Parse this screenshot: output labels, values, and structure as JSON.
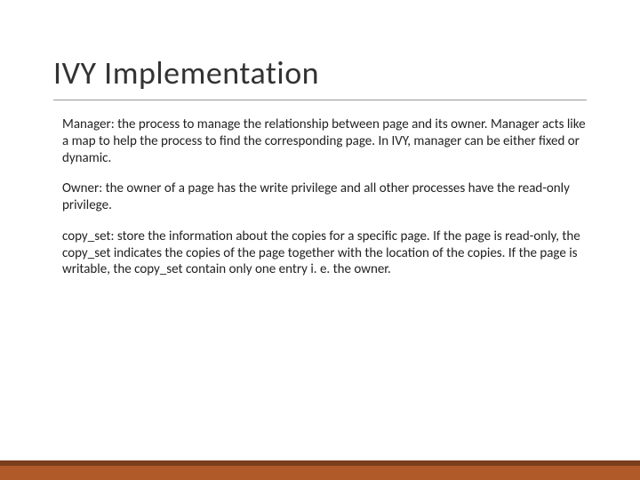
{
  "slide": {
    "title": "IVY Implementation",
    "paragraphs": [
      "Manager: the process to manage the relationship between  page and its owner. Manager acts like a map to help the process to find the corresponding page. In IVY, manager can be either fixed or dynamic.",
      "Owner: the owner of a page has the write privilege and all other processes have the read-only privilege.",
      "copy_set: store the information about the copies for a specific page. If the page is read-only, the copy_set indicates the copies of the page together with the location of the copies. If the page is writable, the copy_set contain only one entry i. e. the owner."
    ]
  }
}
